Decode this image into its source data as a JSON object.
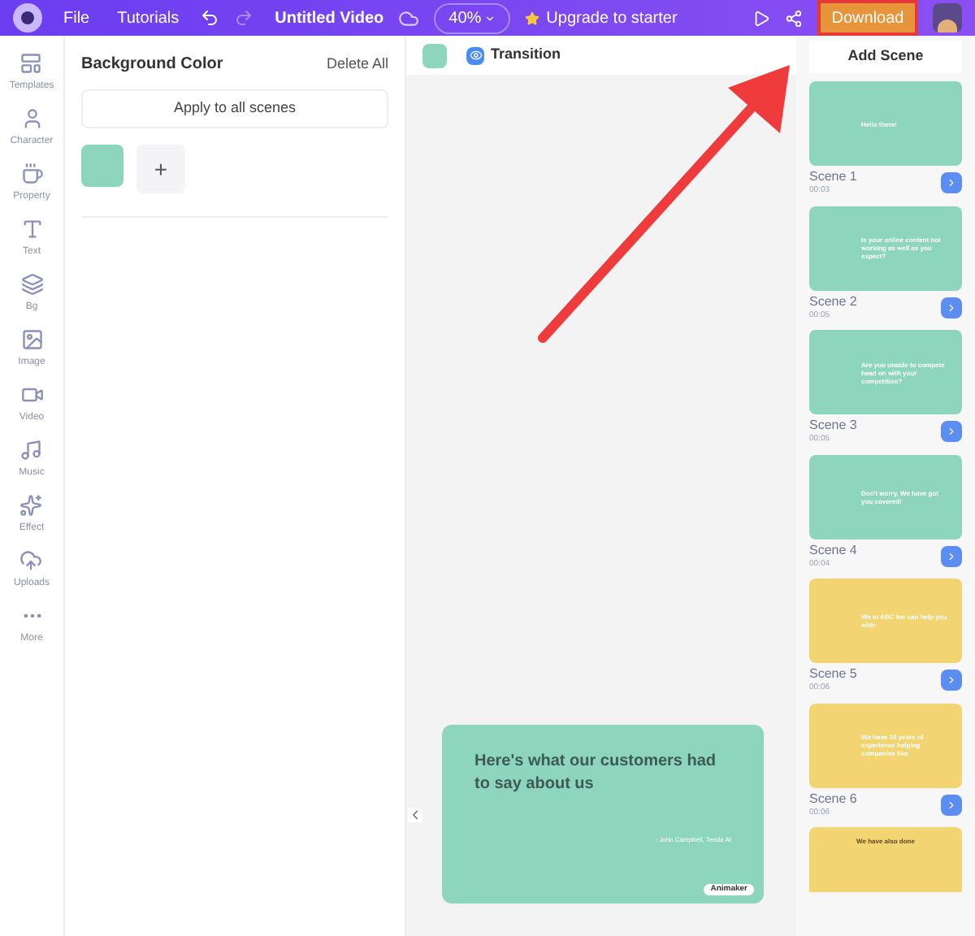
{
  "topbar": {
    "menu": [
      "File",
      "Tutorials"
    ],
    "title": "Untitled Video",
    "zoom": "40%",
    "upgrade": "Upgrade to starter",
    "download": "Download",
    "download_highlighted": true
  },
  "sidebar": {
    "items": [
      {
        "label": "Templates",
        "kind": "templates"
      },
      {
        "label": "Character",
        "kind": "character"
      },
      {
        "label": "Property",
        "kind": "property"
      },
      {
        "label": "Text",
        "kind": "text"
      },
      {
        "label": "Bg",
        "kind": "bg"
      },
      {
        "label": "Image",
        "kind": "image"
      },
      {
        "label": "Video",
        "kind": "video"
      },
      {
        "label": "Music",
        "kind": "music"
      },
      {
        "label": "Effect",
        "kind": "effect"
      },
      {
        "label": "Uploads",
        "kind": "uploads"
      },
      {
        "label": "More",
        "kind": "more"
      }
    ]
  },
  "panel": {
    "title": "Background Color",
    "delete": "Delete All",
    "apply": "Apply to all scenes",
    "swatches": [
      {
        "color": "#8dd5bd"
      }
    ],
    "add": "+"
  },
  "toolbar": {
    "swatch": {
      "color": "#8dd5bd"
    },
    "transition": "Transition"
  },
  "canvas": {
    "heading": "Here's what our customers had to say about us",
    "author": "- John Campbell, Tenda AI",
    "badge": "Animaker"
  },
  "scenes_panel": {
    "add": "Add Scene",
    "scenes": [
      {
        "name": "Scene 1",
        "duration": "00:03",
        "color": "#8dd5bd",
        "text": "Hello there!"
      },
      {
        "name": "Scene 2",
        "duration": "00:05",
        "color": "#8dd5bd",
        "text": "Is your online content not working as well as you expect?"
      },
      {
        "name": "Scene 3",
        "duration": "00:05",
        "color": "#8dd5bd",
        "text": "Are you unable to compete head on with your competition?"
      },
      {
        "name": "Scene 4",
        "duration": "00:04",
        "color": "#8dd5bd",
        "text": "Don't worry, We have got you covered!"
      },
      {
        "name": "Scene 5",
        "duration": "00:06",
        "color": "#f2d472",
        "text": "We at ABC Inc can help you with:"
      },
      {
        "name": "Scene 6",
        "duration": "00:06",
        "color": "#f2d472",
        "text": "We have 10 years of experience helping companies like"
      }
    ],
    "partial_scene": {
      "color": "#f2d472",
      "text": "We have also done"
    }
  }
}
